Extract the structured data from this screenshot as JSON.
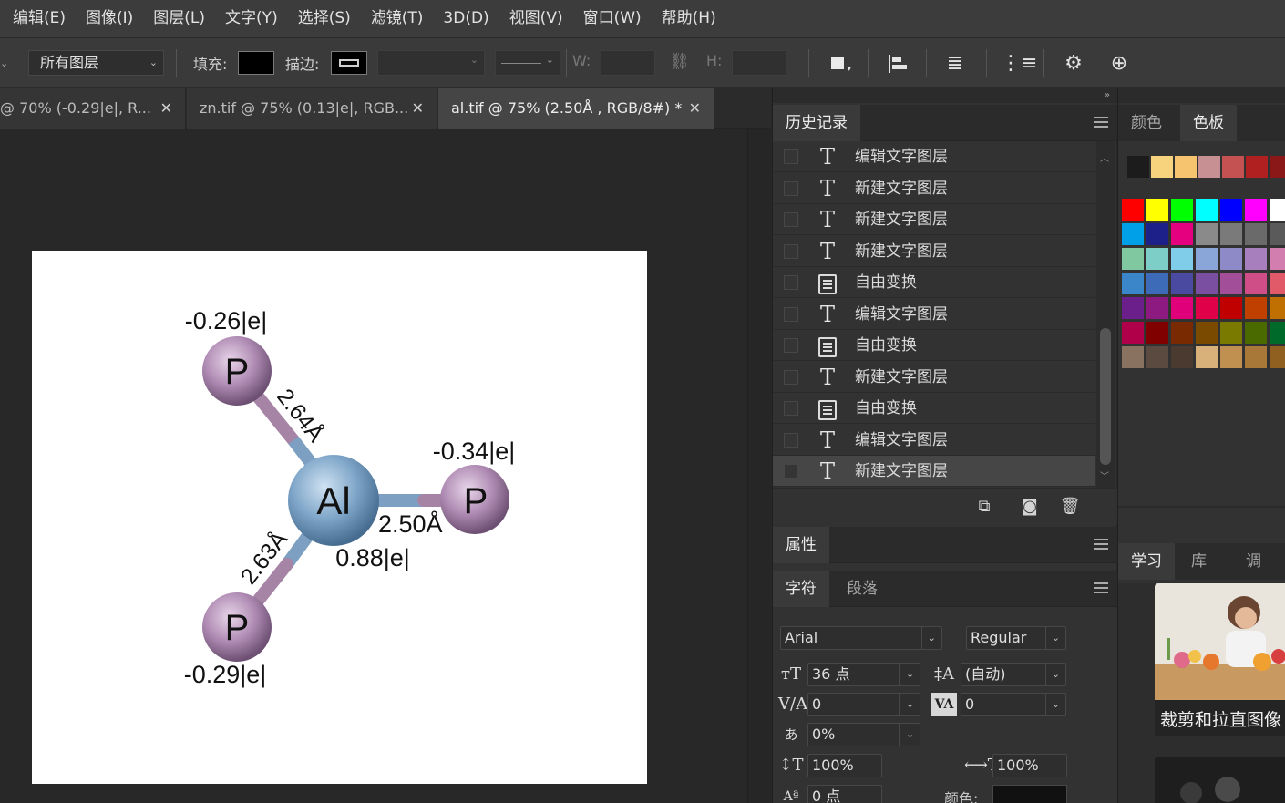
{
  "menu": [
    "编辑(E)",
    "图像(I)",
    "图层(L)",
    "文字(Y)",
    "选择(S)",
    "滤镜(T)",
    "3D(D)",
    "视图(V)",
    "窗口(W)",
    "帮助(H)"
  ],
  "options": {
    "layer_select": "所有图层",
    "fill_label": "填充:",
    "stroke_label": "描边:",
    "w_label": "W:",
    "h_label": "H:"
  },
  "doc_tabs": [
    {
      "label": "@ 70% (-0.29|e|, R...",
      "active": false
    },
    {
      "label": "zn.tif @ 75% (0.13|e|, RGB...",
      "active": false
    },
    {
      "label": "al.tif @ 75% (2.50Å , RGB/8#) *",
      "active": true
    }
  ],
  "molecule": {
    "center_atom": "Al",
    "center_charge": "0.88|e|",
    "atoms": [
      {
        "symbol": "P",
        "charge": "-0.26|e|",
        "bond": "2.64Å"
      },
      {
        "symbol": "P",
        "charge": "-0.34|e|",
        "bond": "2.50Å"
      },
      {
        "symbol": "P",
        "charge": "-0.29|e|",
        "bond": "2.63Å"
      }
    ]
  },
  "history": {
    "tab": "历史记录",
    "items": [
      {
        "icon": "type",
        "glyph": "T",
        "label": "编辑文字图层"
      },
      {
        "icon": "type",
        "glyph": "T",
        "label": "新建文字图层"
      },
      {
        "icon": "type",
        "glyph": "T",
        "label": "新建文字图层"
      },
      {
        "icon": "type",
        "glyph": "T",
        "label": "新建文字图层"
      },
      {
        "icon": "doc",
        "glyph": "",
        "label": "自由变换"
      },
      {
        "icon": "type",
        "glyph": "T",
        "label": "编辑文字图层"
      },
      {
        "icon": "doc",
        "glyph": "",
        "label": "自由变换"
      },
      {
        "icon": "type",
        "glyph": "T",
        "label": "新建文字图层"
      },
      {
        "icon": "doc",
        "glyph": "",
        "label": "自由变换"
      },
      {
        "icon": "type",
        "glyph": "T",
        "label": "编辑文字图层"
      },
      {
        "icon": "type",
        "glyph": "T",
        "label": "新建文字图层"
      }
    ]
  },
  "properties_tab": "属性",
  "character": {
    "tabs": [
      "字符",
      "段落"
    ],
    "font_family": "Arial",
    "font_style": "Regular",
    "size": "36 点",
    "leading": "(自动)",
    "kerning": "0",
    "tracking": "0",
    "tsume": "0%",
    "vscale": "100%",
    "hscale": "100%",
    "baseline": "0 点",
    "color_label": "颜色:"
  },
  "swatches": {
    "tabs": [
      "颜色",
      "色板"
    ],
    "recent": [
      "#1c1c1c",
      "#f6d37c",
      "#f6c46e",
      "#c79092",
      "#c45252",
      "#b02020",
      "#8a1818"
    ],
    "grid": [
      [
        "#ff0000",
        "#ffff00",
        "#00ff00",
        "#00ffff",
        "#0000ff",
        "#ff00ff",
        "#ffffff"
      ],
      [
        "#00a0e9",
        "#1d2088",
        "#e4007f",
        "#8a8a8a",
        "#7a7a7a",
        "#6a6a6a",
        "#5a5a5a"
      ],
      [
        "#7fc8a0",
        "#7ecec8",
        "#80cdea",
        "#8aa6d8",
        "#8e8ac8",
        "#a77fbc",
        "#d27fb0"
      ],
      [
        "#3a86c8",
        "#3d6bb8",
        "#4a4aa0",
        "#7a4ea0",
        "#a24e98",
        "#d04e88",
        "#e05a6a"
      ],
      [
        "#6a1f8a",
        "#8c1a80",
        "#e0007a",
        "#e0004a",
        "#c00000",
        "#c04000",
        "#c07000"
      ],
      [
        "#b0004a",
        "#800000",
        "#7a2a00",
        "#7a4a00",
        "#7a7a00",
        "#4a6a00",
        "#006a2a"
      ],
      [
        "#8a7260",
        "#5a4a40",
        "#4a3a30",
        "#d8b07a",
        "#c09050",
        "#a87838",
        "#906020"
      ]
    ]
  },
  "learn": {
    "tabs": [
      "学习",
      "库",
      "调整"
    ],
    "card_title": "裁剪和拉直图像"
  }
}
